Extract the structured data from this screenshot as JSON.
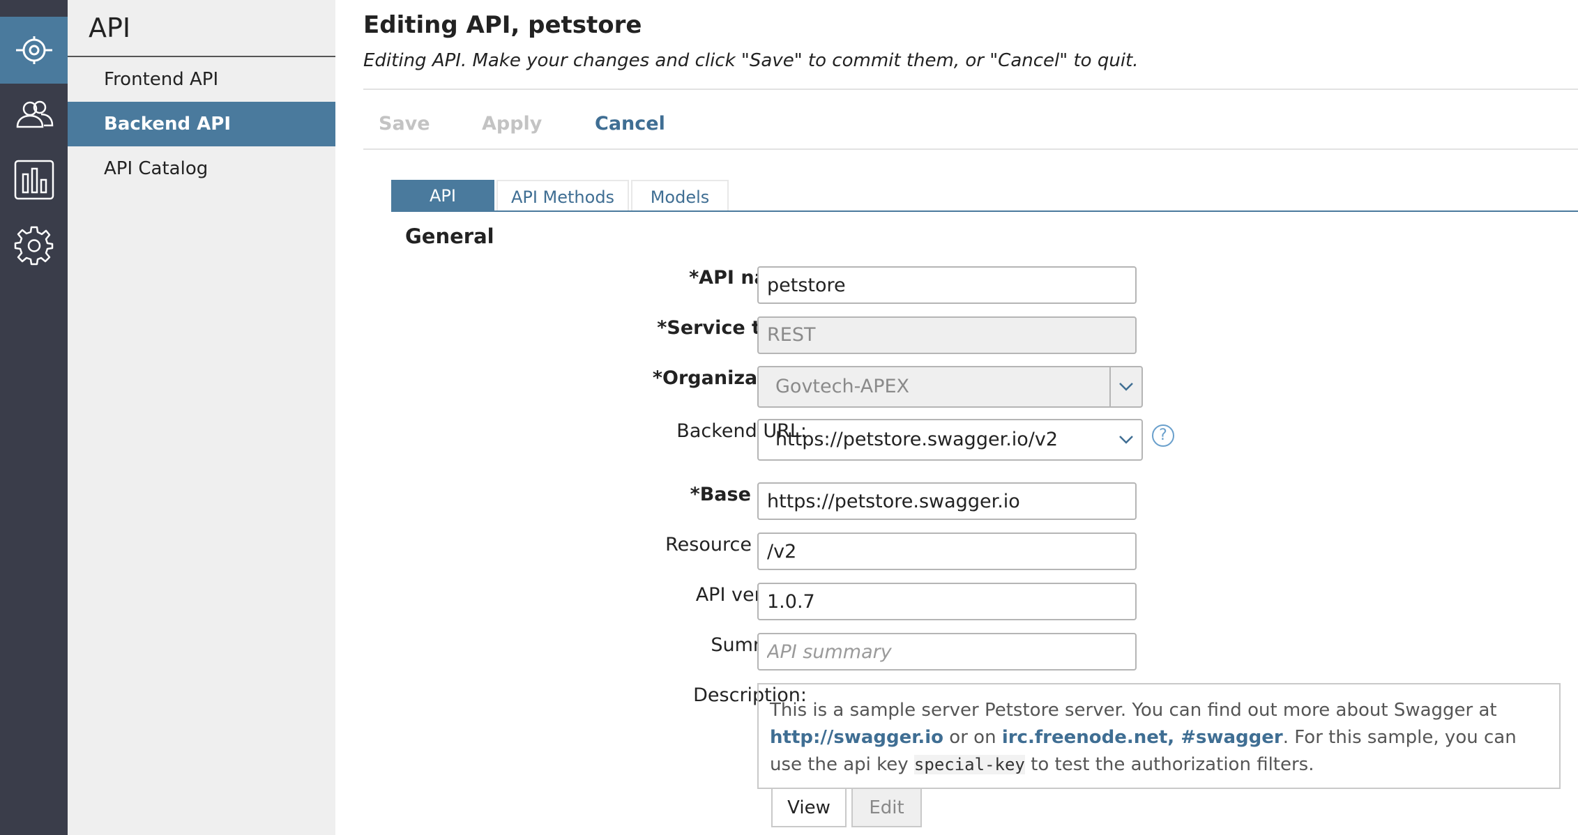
{
  "rail": {
    "items": [
      {
        "icon": "api-target-icon",
        "active": true
      },
      {
        "icon": "users-icon",
        "active": false
      },
      {
        "icon": "bar-chart-icon",
        "active": false
      },
      {
        "icon": "gear-icon",
        "active": false
      }
    ]
  },
  "nav": {
    "title": "API",
    "items": [
      {
        "label": "Frontend API",
        "active": false
      },
      {
        "label": "Backend API",
        "active": true
      },
      {
        "label": "API Catalog",
        "active": false
      }
    ]
  },
  "header": {
    "title": "Editing API, petstore",
    "subtitle": "Editing API. Make your changes and click \"Save\" to commit them, or \"Cancel\" to quit."
  },
  "actions": {
    "save": "Save",
    "apply": "Apply",
    "cancel": "Cancel"
  },
  "tabs": [
    {
      "label": "API",
      "active": true
    },
    {
      "label": "API Methods",
      "active": false
    },
    {
      "label": "Models",
      "active": false
    }
  ],
  "section": {
    "title": "General"
  },
  "form": {
    "api_name": {
      "label": "*API name:",
      "value": "petstore"
    },
    "service_type": {
      "label": "*Service type:",
      "value": "REST"
    },
    "organization": {
      "label": "*Organization:",
      "value": "Govtech-APEX"
    },
    "backend_url": {
      "label": "Backend URL:",
      "value": "https://petstore.swagger.io/v2",
      "help": "?"
    },
    "base_url": {
      "label": "*Base URL:",
      "value": "https://petstore.swagger.io"
    },
    "resource_path": {
      "label": "Resource path:",
      "value": "/v2"
    },
    "api_version": {
      "label": "API version:",
      "value": "1.0.7"
    },
    "summary": {
      "label": "Summary:",
      "value": "",
      "placeholder": "API summary"
    },
    "description": {
      "label": "Description:",
      "text_1": "This is a sample server Petstore server. You can find out more about Swagger at ",
      "link_1": "http://swagger.io",
      "text_2": " or on ",
      "link_2": "irc.freenode.net, #swagger",
      "text_3": ". For this sample, you can use the api key ",
      "code": "special-key",
      "text_4": " to test the authorization filters.",
      "view_tab": "View",
      "edit_tab": "Edit"
    }
  },
  "colors": {
    "rail_bg": "#3a3d4a",
    "accent": "#4a7a9d",
    "link": "#3f6e93",
    "nav_bg": "#efefef"
  }
}
